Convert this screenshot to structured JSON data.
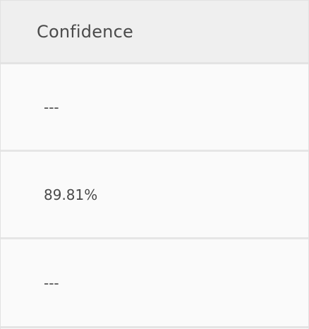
{
  "table": {
    "column_header": "Confidence",
    "rows": [
      {
        "value": "---"
      },
      {
        "value": "89.81%"
      },
      {
        "value": "---"
      }
    ]
  }
}
